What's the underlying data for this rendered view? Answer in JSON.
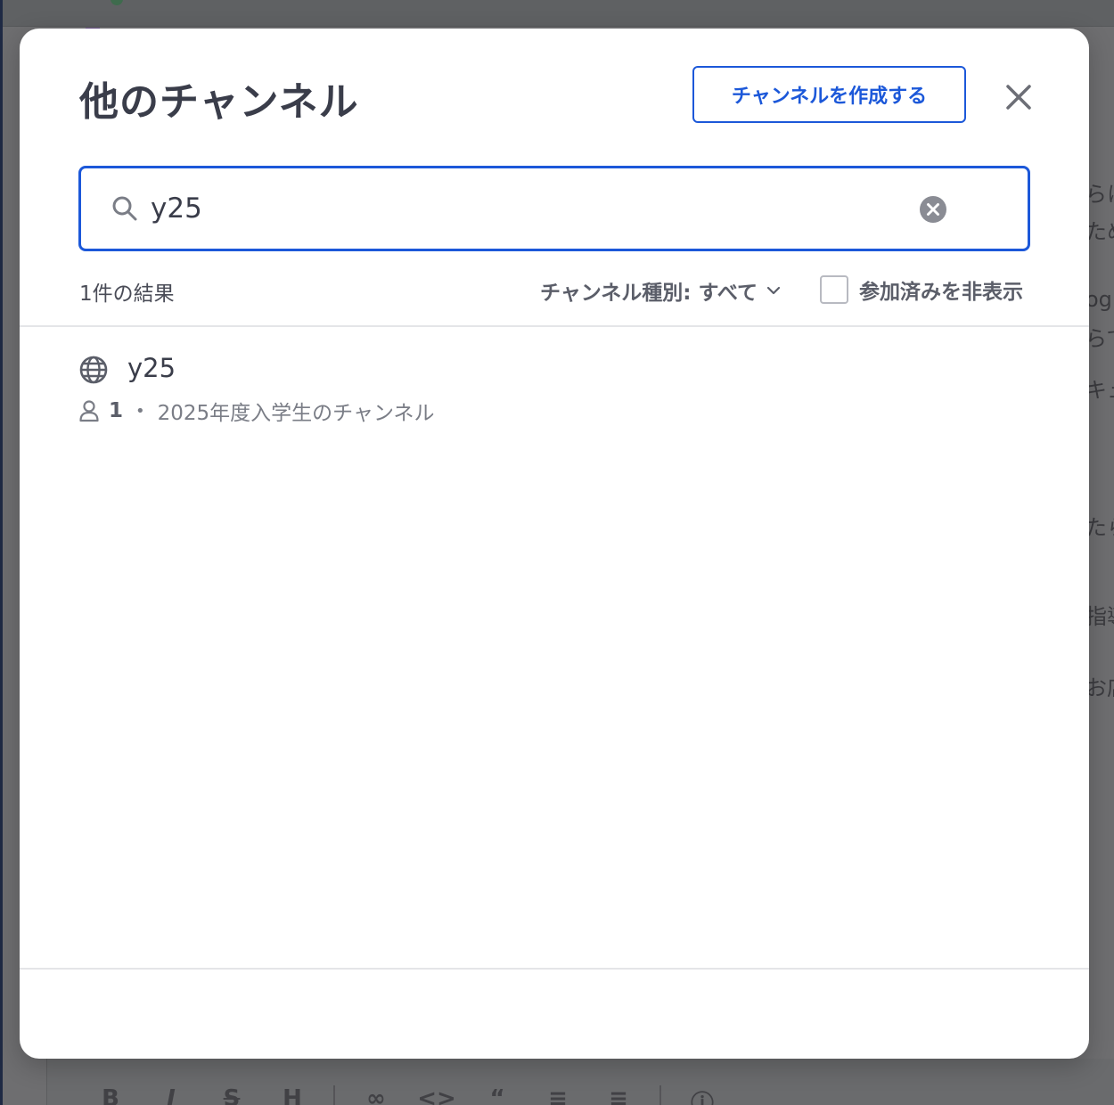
{
  "modal": {
    "title": "他のチャンネル",
    "create_button_label": "チャンネルを作成する",
    "close_label": "close"
  },
  "search": {
    "value": "y25",
    "placeholder": ""
  },
  "filters": {
    "result_count": "1件の結果",
    "channel_type_label": "チャンネル種別: すべて",
    "hide_joined_label": "参加済みを非表示",
    "hide_joined_checked": false
  },
  "results": [
    {
      "name": "y25",
      "member_count": "1",
      "separator": "•",
      "purpose": "2025年度入学生のチャンネル",
      "icon": "globe-icon"
    }
  ],
  "background": {
    "snippets": [
      "らに",
      "ため",
      "og.",
      "らて",
      "キュ",
      "たら",
      "指導",
      "お店"
    ]
  },
  "colors": {
    "accent": "#1c58d9",
    "title_text": "#3a3d4a",
    "overlay": "#6e6e70"
  }
}
